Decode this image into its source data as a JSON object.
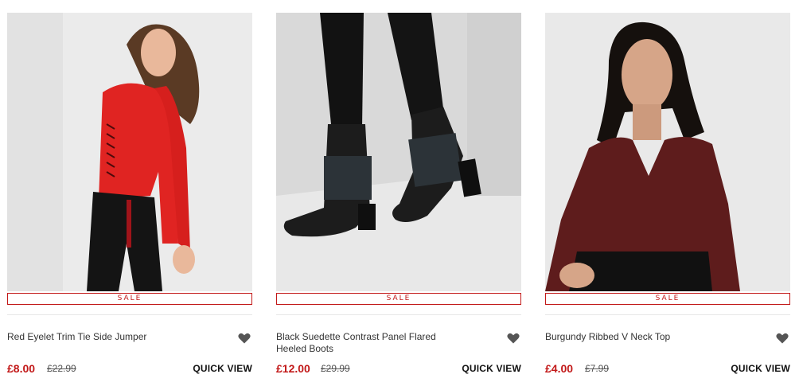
{
  "colors": {
    "sale": "#c21818",
    "text": "#333333",
    "heart": "#555555"
  },
  "products": [
    {
      "name": "Red Eyelet Trim Tie Side Jumper",
      "badge": "SALE",
      "price": "£8.00",
      "was_price": "£22.99",
      "quick_view": "QUICK VIEW",
      "wishlist_icon": "heart-icon",
      "image": "woman-red-jumper-photo"
    },
    {
      "name": "Black Suedette Contrast Panel Flared Heeled Boots",
      "badge": "SALE",
      "price": "£12.00",
      "was_price": "£29.99",
      "quick_view": "QUICK VIEW",
      "wishlist_icon": "heart-icon",
      "image": "black-heeled-boots-photo"
    },
    {
      "name": "Burgundy Ribbed V Neck Top",
      "badge": "SALE",
      "price": "£4.00",
      "was_price": "£7.99",
      "quick_view": "QUICK VIEW",
      "wishlist_icon": "heart-icon",
      "image": "woman-burgundy-top-photo"
    }
  ]
}
